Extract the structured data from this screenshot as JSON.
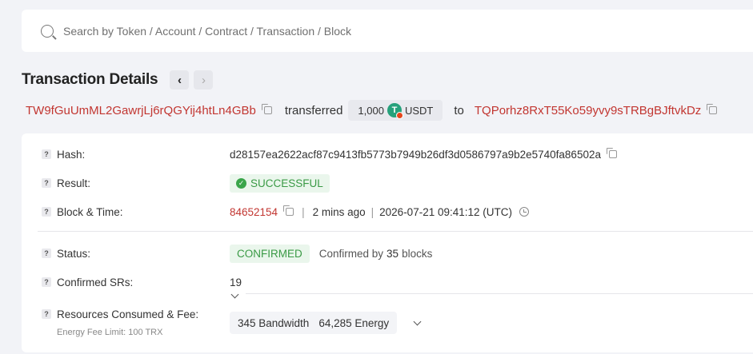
{
  "search": {
    "placeholder": "Search by Token / Account / Contract / Transaction / Block"
  },
  "header": {
    "title": "Transaction Details",
    "prev": "‹",
    "next": "›"
  },
  "transfer": {
    "from": "TW9fGuUmML2GawrjLj6rQGYij4htLn4GBb",
    "verb": "transferred",
    "amount": "1,000",
    "token_icon": "T",
    "token": "USDT",
    "to_word": "to",
    "to": "TQPorhz8RxT55Ko59yvy9sTRBgBJftvkDz"
  },
  "details": {
    "hash": {
      "label": "Hash:",
      "value": "d28157ea2622acf87c9413fb5773b7949b26df3d0586797a9b2e5740fa86502a"
    },
    "result": {
      "label": "Result:",
      "value": "SUCCESSFUL",
      "check": "✓"
    },
    "block_time": {
      "label": "Block & Time:",
      "block": "84652154",
      "sep": "|",
      "ago": "2 mins ago",
      "sep2": "|",
      "time": "2026-07-21 09:41:12 (UTC)"
    },
    "status": {
      "label": "Status:",
      "value": "CONFIRMED",
      "confirmed_prefix": "Confirmed by",
      "confirmed_count": "35",
      "confirmed_suffix": "blocks"
    },
    "srs": {
      "label": "Confirmed SRs:",
      "value": "19"
    },
    "resources": {
      "label": "Resources Consumed & Fee:",
      "sub_label": "Energy Fee Limit: 100 TRX",
      "bandwidth": "345 Bandwidth",
      "energy": "64,285 Energy"
    }
  },
  "help_icon": "?",
  "colors": {
    "accent_red": "#c23631",
    "success_green": "#3a9a45",
    "usdt_green": "#26a17b"
  }
}
